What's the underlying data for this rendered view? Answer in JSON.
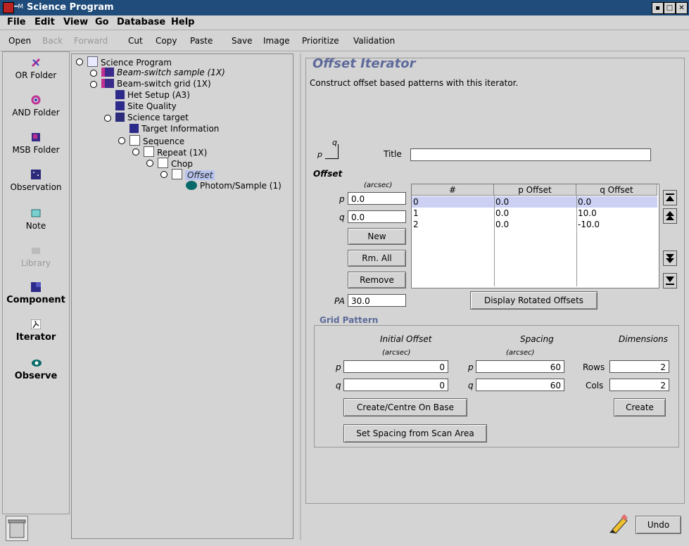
{
  "window": {
    "title": "Science Program"
  },
  "menubar": {
    "items": [
      "File",
      "Edit",
      "View",
      "Go",
      "Database",
      "Help"
    ]
  },
  "toolbar": {
    "open": "Open",
    "back": "Back",
    "forward": "Forward",
    "cut": "Cut",
    "copy": "Copy",
    "paste": "Paste",
    "save": "Save",
    "image": "Image",
    "prioritize": "Prioritize",
    "validation": "Validation"
  },
  "palette": {
    "or_folder": "OR Folder",
    "and_folder": "AND Folder",
    "msb_folder": "MSB Folder",
    "observation": "Observation",
    "note": "Note",
    "library": "Library",
    "component": "Component",
    "iterator": "Iterator",
    "observe": "Observe"
  },
  "tree": {
    "root": "Science Program",
    "beam_switch_sample": "Beam-switch sample (1X)",
    "beam_switch_grid": "Beam-switch grid (1X)",
    "het_setup": "Het Setup (A3)",
    "site_quality": "Site Quality",
    "science_target": "Science target",
    "target_information": "Target Information",
    "sequence": "Sequence",
    "repeat": "Repeat (1X)",
    "chop": "Chop",
    "offset": "Offset",
    "photom": "Photom/Sample (1)"
  },
  "editor": {
    "heading": "Offset Iterator",
    "description": "Construct offset based patterns with this iterator.",
    "q_axis": "q",
    "p_axis": "p",
    "title_label": "Title",
    "title_value": "",
    "offset_label": "Offset",
    "arcsec": "(arcsec)",
    "p_label": "p",
    "p_value": "0.0",
    "q_label": "q",
    "q_value": "0.0",
    "new_button": "New",
    "rm_all_button": "Rm. All",
    "remove_button": "Remove",
    "pa_label": "PA",
    "pa_value": "30.0",
    "display_rotated": "Display Rotated Offsets",
    "table": {
      "headers": [
        "#",
        "p Offset",
        "q Offset"
      ],
      "rows": [
        [
          "0",
          "0.0",
          "0.0"
        ],
        [
          "1",
          "0.0",
          "10.0"
        ],
        [
          "2",
          "0.0",
          "-10.0"
        ]
      ]
    }
  },
  "grid": {
    "title": "Grid Pattern",
    "initial_offset": "Initial Offset",
    "spacing": "Spacing",
    "dimensions": "Dimensions",
    "arcsec": "(arcsec)",
    "p": "p",
    "q": "q",
    "init_p": "0",
    "init_q": "0",
    "spacing_p": "60",
    "spacing_q": "60",
    "rows_label": "Rows",
    "rows_value": "2",
    "cols_label": "Cols",
    "cols_value": "2",
    "create_centre": "Create/Centre On Base",
    "create": "Create",
    "set_spacing": "Set Spacing from Scan Area"
  },
  "footer": {
    "undo": "Undo"
  }
}
